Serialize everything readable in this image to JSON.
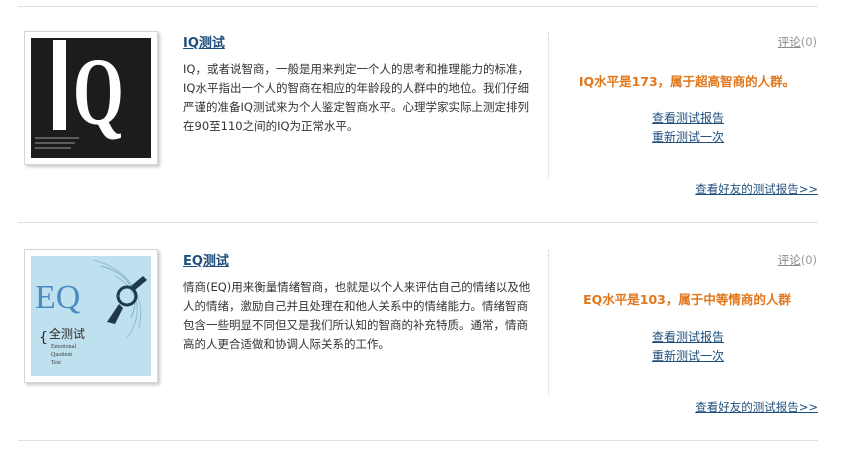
{
  "tests": [
    {
      "title": "IQ测试",
      "cover_lettering": "IQ",
      "description": "IQ，或者说智商，一般是用来判定一个人的思考和推理能力的标准，IQ水平指出一个人的智商在相应的年龄段的人群中的地位。我们仔细严谨的准备IQ测试来为个人鉴定智商水平。心理学家实际上测定排列在90至110之间的IQ为正常水平。",
      "comments_label": "评论",
      "comments_count": "(0)",
      "result": "IQ水平是173，属于超高智商的人群。",
      "view_report": "查看测试报告",
      "retest": "重新测试一次",
      "friends_reports": "查看好友的测试报告>>"
    },
    {
      "title": "EQ测试",
      "cover_lettering": "EQ 全测试 Emotional Quotient Test",
      "description": "情商(EQ)用来衡量情绪智商，也就是以个人来评估自己的情绪以及他人的情绪，激励自己并且处理在和他人关系中的情绪能力。情绪智商包含一些明显不同但又是我们所认知的智商的补充特质。通常，情商高的人更合适做和协调人际关系的工作。",
      "comments_label": "评论",
      "comments_count": "(0)",
      "result": "EQ水平是103，属于中等情商的人群",
      "view_report": "查看测试报告",
      "retest": "重新测试一次",
      "friends_reports": "查看好友的测试报告>>"
    }
  ]
}
